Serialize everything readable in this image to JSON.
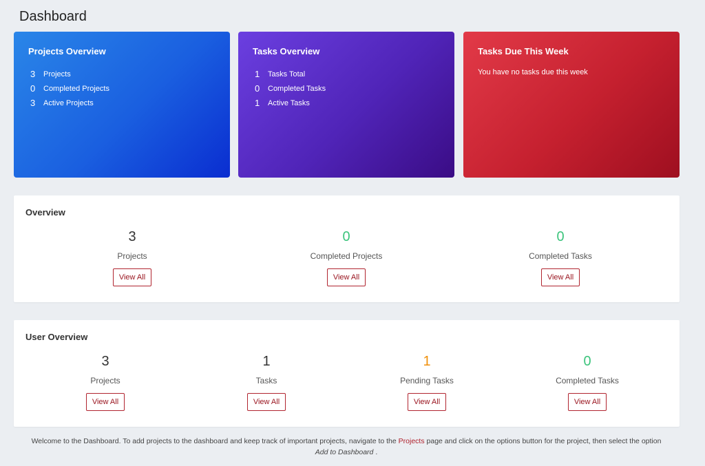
{
  "page_title": "Dashboard",
  "cards": {
    "projects": {
      "title": "Projects Overview",
      "stats": [
        {
          "value": "3",
          "label": "Projects"
        },
        {
          "value": "0",
          "label": "Completed Projects"
        },
        {
          "value": "3",
          "label": "Active Projects"
        }
      ]
    },
    "tasks": {
      "title": "Tasks Overview",
      "stats": [
        {
          "value": "1",
          "label": "Tasks Total"
        },
        {
          "value": "0",
          "label": "Completed Tasks"
        },
        {
          "value": "1",
          "label": "Active Tasks"
        }
      ]
    },
    "due": {
      "title": "Tasks Due This Week",
      "message": "You have no tasks due this week"
    }
  },
  "overview": {
    "title": "Overview",
    "metrics": [
      {
        "value": "3",
        "label": "Projects",
        "button": "View All"
      },
      {
        "value": "0",
        "label": "Completed Projects",
        "button": "View All"
      },
      {
        "value": "0",
        "label": "Completed Tasks",
        "button": "View All"
      }
    ]
  },
  "user_overview": {
    "title": "User Overview",
    "metrics": [
      {
        "value": "3",
        "label": "Projects",
        "button": "View All"
      },
      {
        "value": "1",
        "label": "Tasks",
        "button": "View All"
      },
      {
        "value": "1",
        "label": "Pending Tasks",
        "button": "View All"
      },
      {
        "value": "0",
        "label": "Completed Tasks",
        "button": "View All"
      }
    ]
  },
  "footer": {
    "text_before": "Welcome to the Dashboard. To add projects to the dashboard and keep track of important projects, navigate to the ",
    "link": "Projects",
    "text_middle": " page and click on the options button for the project, then select the option",
    "option": "Add to Dashboard",
    "text_after": " ."
  },
  "colors": {
    "accent_red": "#b0232e",
    "green": "#3cc47c",
    "orange": "#f0900a",
    "blue_card": "#1a5fe0",
    "purple_card": "#5024b8",
    "red_card": "#c5202f"
  }
}
